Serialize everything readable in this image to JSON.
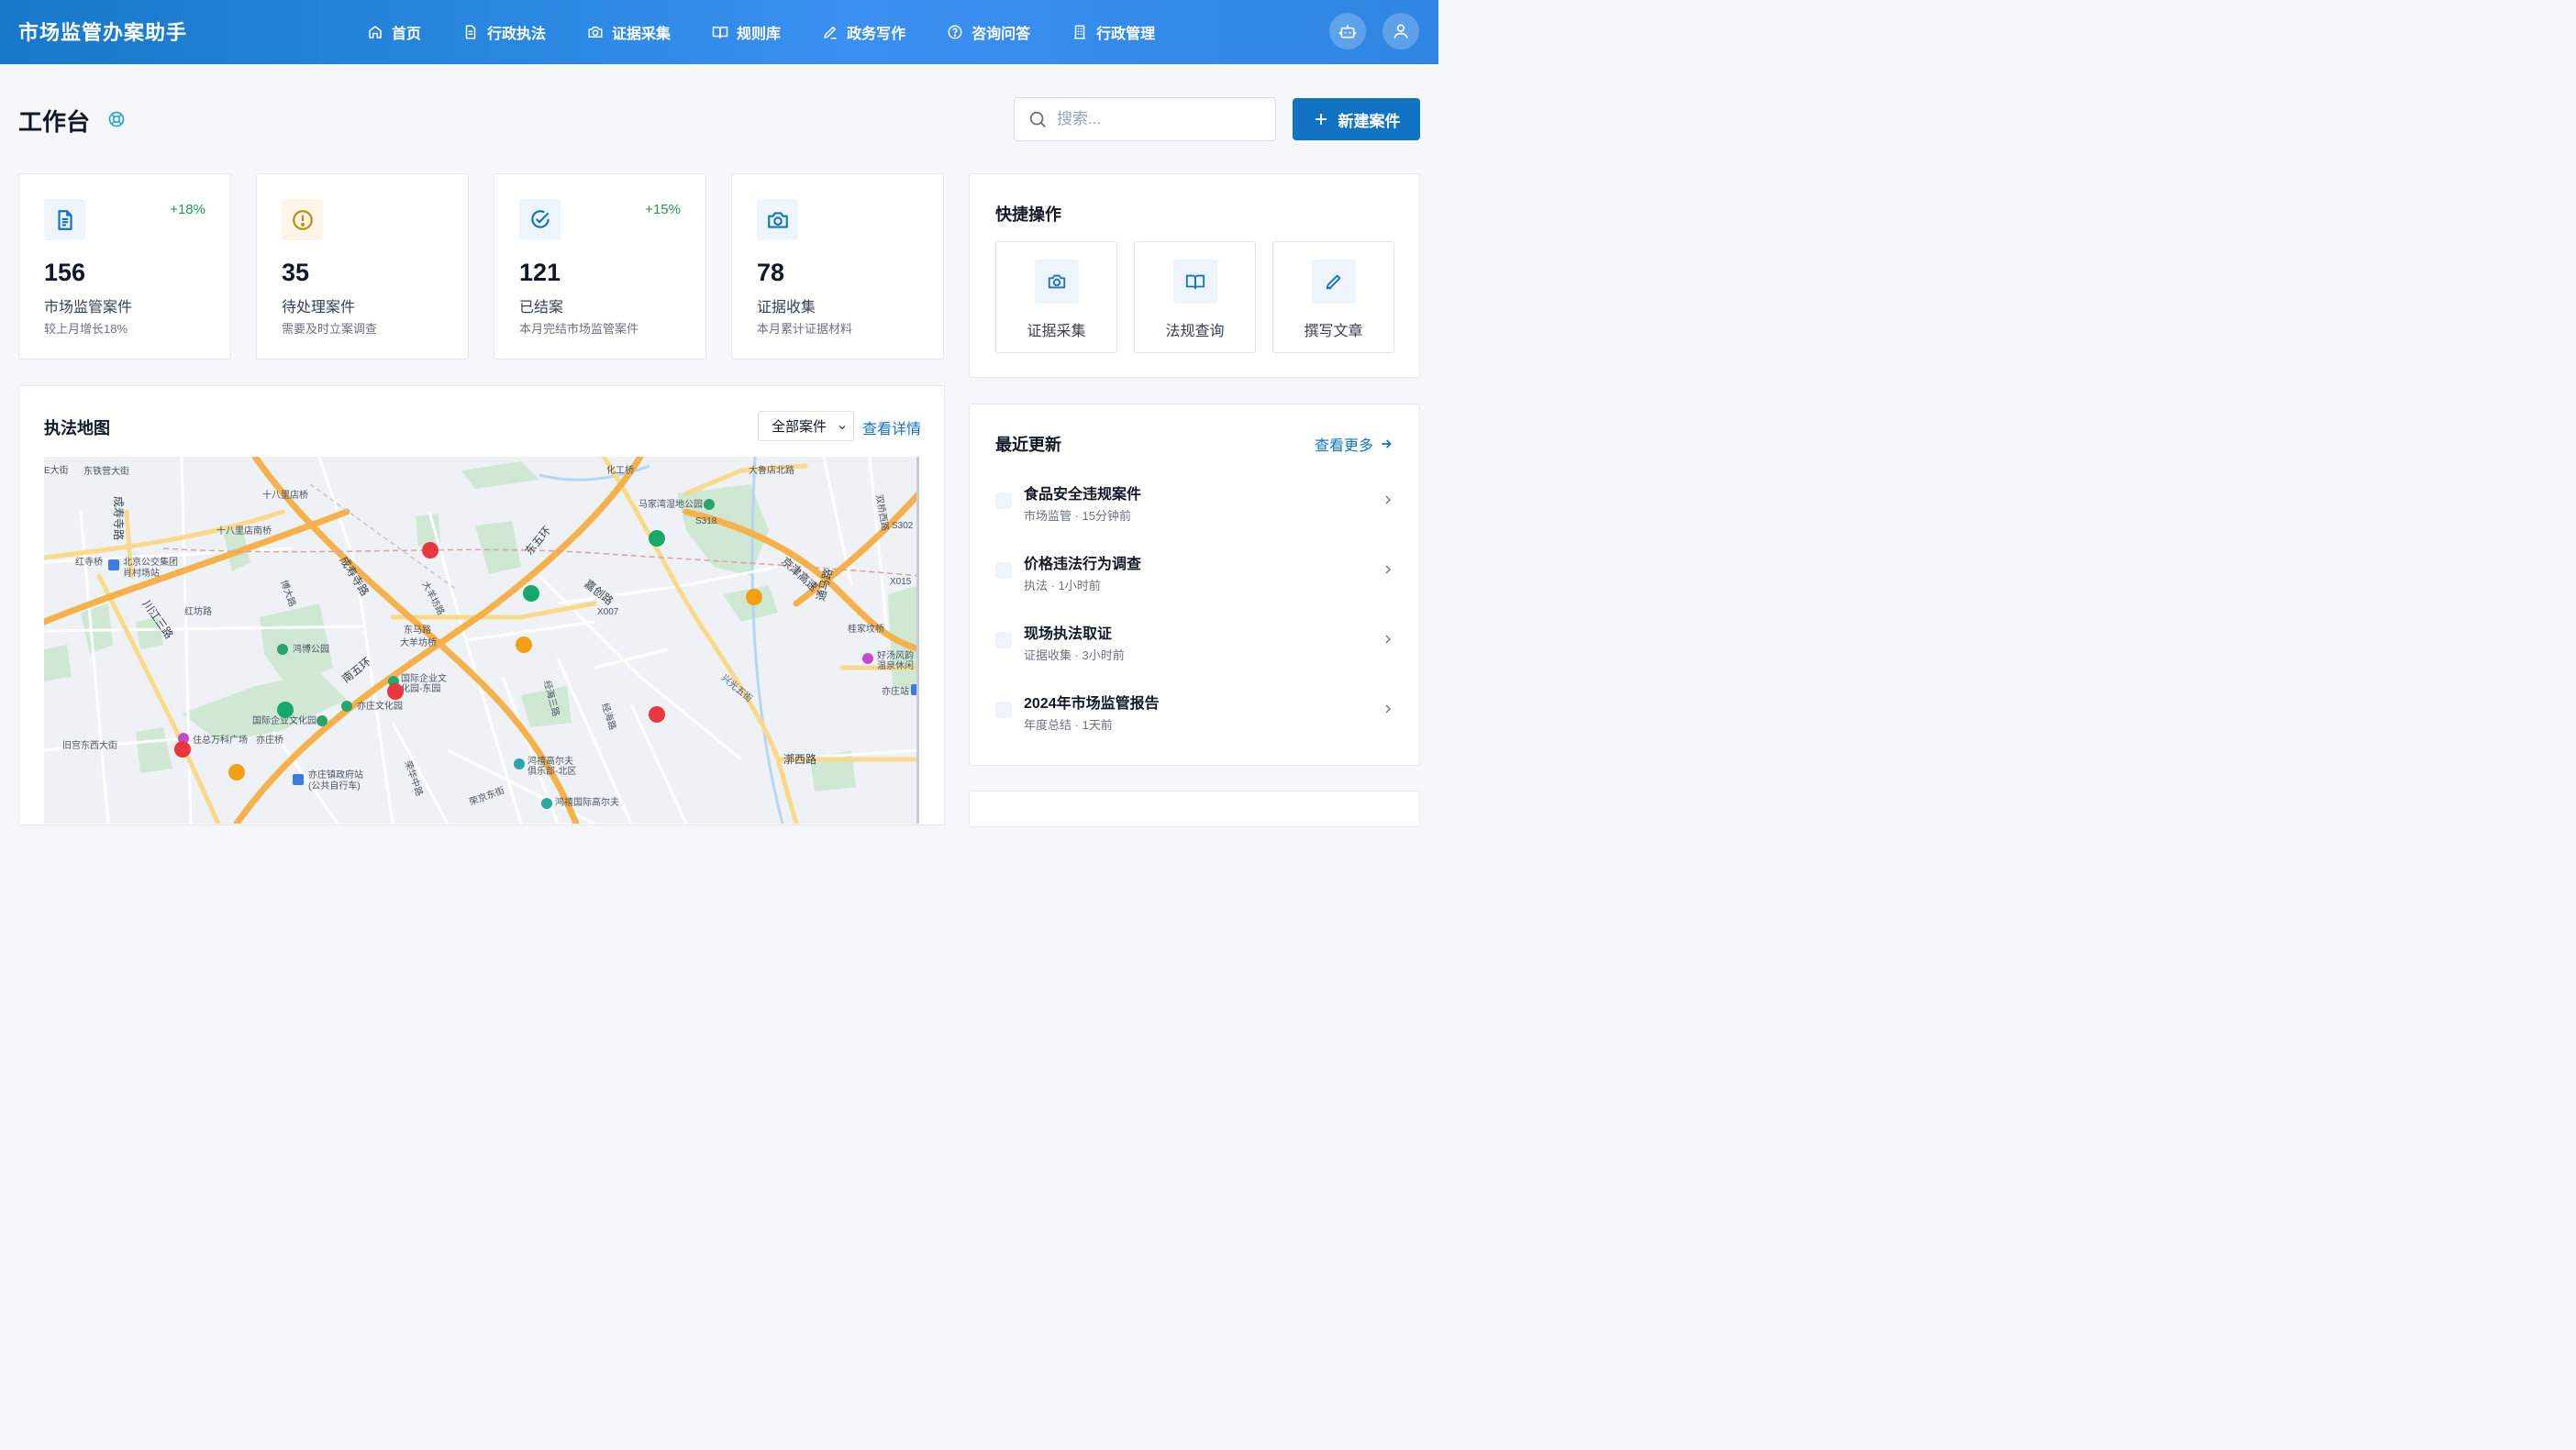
{
  "app": {
    "title": "市场监管办案助手"
  },
  "nav": {
    "items": [
      {
        "label": "首页",
        "icon": "home-icon"
      },
      {
        "label": "行政执法",
        "icon": "document-icon"
      },
      {
        "label": "证据采集",
        "icon": "camera-icon"
      },
      {
        "label": "规则库",
        "icon": "book-icon"
      },
      {
        "label": "政务写作",
        "icon": "pen-icon"
      },
      {
        "label": "咨询问答",
        "icon": "help-circle-icon"
      },
      {
        "label": "行政管理",
        "icon": "building-icon"
      }
    ],
    "right_icons": [
      "robot-icon",
      "user-icon"
    ]
  },
  "page": {
    "title": "工作台",
    "title_icon": "lifebuoy-icon"
  },
  "search": {
    "placeholder": "搜索..."
  },
  "new_case": {
    "label": "新建案件"
  },
  "stats": [
    {
      "icon": "document-icon",
      "change": "+18%",
      "value": "156",
      "label": "市场监管案件",
      "sub": "较上月增长18%",
      "icon_color": "#1273c4"
    },
    {
      "icon": "alert-circle-icon",
      "change": "",
      "value": "35",
      "label": "待处理案件",
      "sub": "需要及时立案调查",
      "icon_color": "#c48a10"
    },
    {
      "icon": "check-circle-icon",
      "change": "+15%",
      "value": "121",
      "label": "已结案",
      "sub": "本月完结市场监管案件",
      "icon_color": "#1273c4"
    },
    {
      "icon": "camera-icon",
      "change": "",
      "value": "78",
      "label": "证据收集",
      "sub": "本月累计证据材料",
      "icon_color": "#1273c4"
    }
  ],
  "map": {
    "title": "执法地图",
    "filter": "全部案件",
    "link": "查看详情",
    "labels": {
      "l1": "E大街",
      "l2": "东铁营大街",
      "l3": "十八里店桥",
      "l4": "十八里店南桥",
      "l5": "成寿寺路",
      "l6": "红寺桥",
      "l7": "北京公交集团",
      "l7b": "肖村场站",
      "l8": "红坊路",
      "l9": "川江三路",
      "l10": "博大路",
      "l11": "成寿寺路",
      "l12": "大羊坊路",
      "l13": "东马路",
      "l14": "大羊坊桥",
      "l15": "鸿博公园",
      "l16": "南五环",
      "l17": "国际企业文",
      "l17b": "化园-东园",
      "l18": "亦庄文化园",
      "l19": "国际企业文化园",
      "l20": "住总万科广场",
      "l21": "亦庄桥",
      "l22": "旧宫东西大街",
      "l23": "亦庄镇政府站",
      "l23b": "(公共自行车)",
      "l24": "荣华中路",
      "l25": "荣京东街",
      "l26": "鸿禧高尔夫",
      "l26b": "俱乐部-北区",
      "l27": "鸿禧国际高尔夫",
      "l28": "东五环",
      "l29": "化工桥",
      "l30": "马家湾湿地公园",
      "l31": "嘉创路",
      "l32": "经海三路",
      "l33": "经海路",
      "l34": "大鲁店北路",
      "l35": "京津高速",
      "l36": "通马路",
      "l37": "兴光五街",
      "l38": "双桥西路",
      "l39": "桂家坟桥",
      "l40": "好汤风韵",
      "l40b": "温泉休闲",
      "l41": "亦庄站",
      "l42": "漷西路",
      "l43": "X007",
      "l44": "X015",
      "l45": "S318",
      "l46": "S302"
    },
    "markers": [
      {
        "status": "red"
      },
      {
        "status": "green"
      },
      {
        "status": "green"
      },
      {
        "status": "orange"
      },
      {
        "status": "orange"
      },
      {
        "status": "red"
      },
      {
        "status": "green"
      },
      {
        "status": "red"
      },
      {
        "status": "red"
      },
      {
        "status": "orange"
      }
    ]
  },
  "quick_actions": {
    "title": "快捷操作",
    "items": [
      {
        "label": "证据采集",
        "icon": "camera-icon"
      },
      {
        "label": "法规查询",
        "icon": "book-icon"
      },
      {
        "label": "撰写文章",
        "icon": "pen-icon"
      }
    ]
  },
  "recent": {
    "title": "最近更新",
    "more": "查看更多",
    "items": [
      {
        "title": "食品安全违规案件",
        "meta": "市场监管 · 15分钟前"
      },
      {
        "title": "价格违法行为调查",
        "meta": "执法 · 1小时前"
      },
      {
        "title": "现场执法取证",
        "meta": "证据收集 · 3小时前"
      },
      {
        "title": "2024年市场监管报告",
        "meta": "年度总结 · 1天前"
      }
    ]
  },
  "colors": {
    "primary": "#1273c4",
    "header_gradient": [
      "#1878c8",
      "#3b8ff0"
    ],
    "positive": "#1f9a4e",
    "marker_red": "#e8373f",
    "marker_green": "#15a86a",
    "marker_orange": "#f2a00f"
  }
}
